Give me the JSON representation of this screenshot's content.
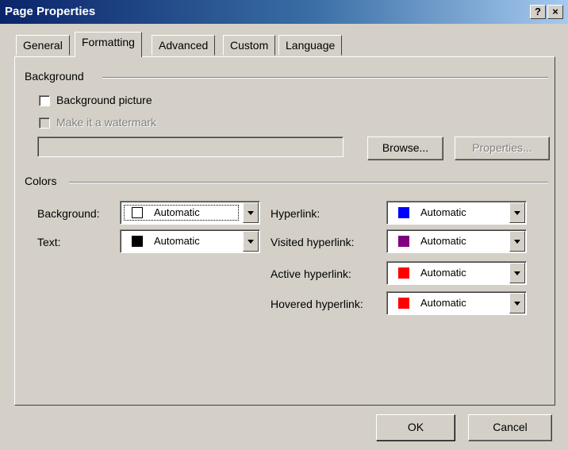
{
  "window": {
    "title": "Page Properties",
    "help_label": "?",
    "close_label": "×"
  },
  "tabs": [
    {
      "label": "General"
    },
    {
      "label": "Formatting"
    },
    {
      "label": "Advanced"
    },
    {
      "label": "Custom"
    },
    {
      "label": "Language"
    }
  ],
  "active_tab": "Formatting",
  "background_group": {
    "title": "Background",
    "background_picture_label": "Background picture",
    "background_picture_checked": false,
    "watermark_label": "Make it a watermark",
    "watermark_enabled": false,
    "picture_path": "",
    "browse_label": "Browse...",
    "properties_label": "Properties..."
  },
  "colors_group": {
    "title": "Colors",
    "background": {
      "label": "Background:",
      "value": "Automatic",
      "swatch": "#ffffff"
    },
    "text": {
      "label": "Text:",
      "value": "Automatic",
      "swatch": "#000000"
    },
    "hyperlink": {
      "label": "Hyperlink:",
      "value": "Automatic",
      "swatch": "#0000ff"
    },
    "visited_hyperlink": {
      "label": "Visited hyperlink:",
      "value": "Automatic",
      "swatch": "#800080"
    },
    "active_hyperlink": {
      "label": "Active hyperlink:",
      "value": "Automatic",
      "swatch": "#ff0000"
    },
    "hovered_hyperlink": {
      "label": "Hovered hyperlink:",
      "value": "Automatic",
      "swatch": "#ff0000"
    }
  },
  "footer": {
    "ok_label": "OK",
    "cancel_label": "Cancel"
  }
}
